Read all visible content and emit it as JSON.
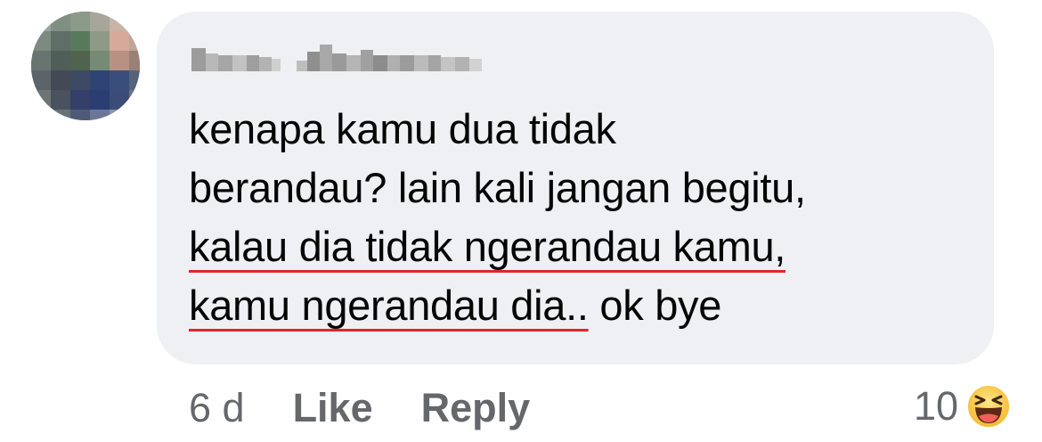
{
  "comment": {
    "author_name": "",
    "lines": [
      "kenapa kamu dua tidak",
      "berandau? lain kali jangan begitu,",
      "kalau dia tidak ngerandau kamu,",
      "kamu ngerandau dia.. ok bye"
    ],
    "line4_plain": " ok bye",
    "line4_underlined": "kamu ngerandau dia..",
    "underlined_lines": [
      2,
      3
    ]
  },
  "actions": {
    "timestamp": "6 d",
    "like_label": "Like",
    "reply_label": "Reply"
  },
  "reactions": {
    "count": "10",
    "icon": "haha-emoji-icon"
  },
  "colors": {
    "bubble": "#eff0f4",
    "text": "#050505",
    "meta": "#65676b",
    "spellcheck_underline": "#e0262f",
    "emoji_face": "#f7c536"
  }
}
